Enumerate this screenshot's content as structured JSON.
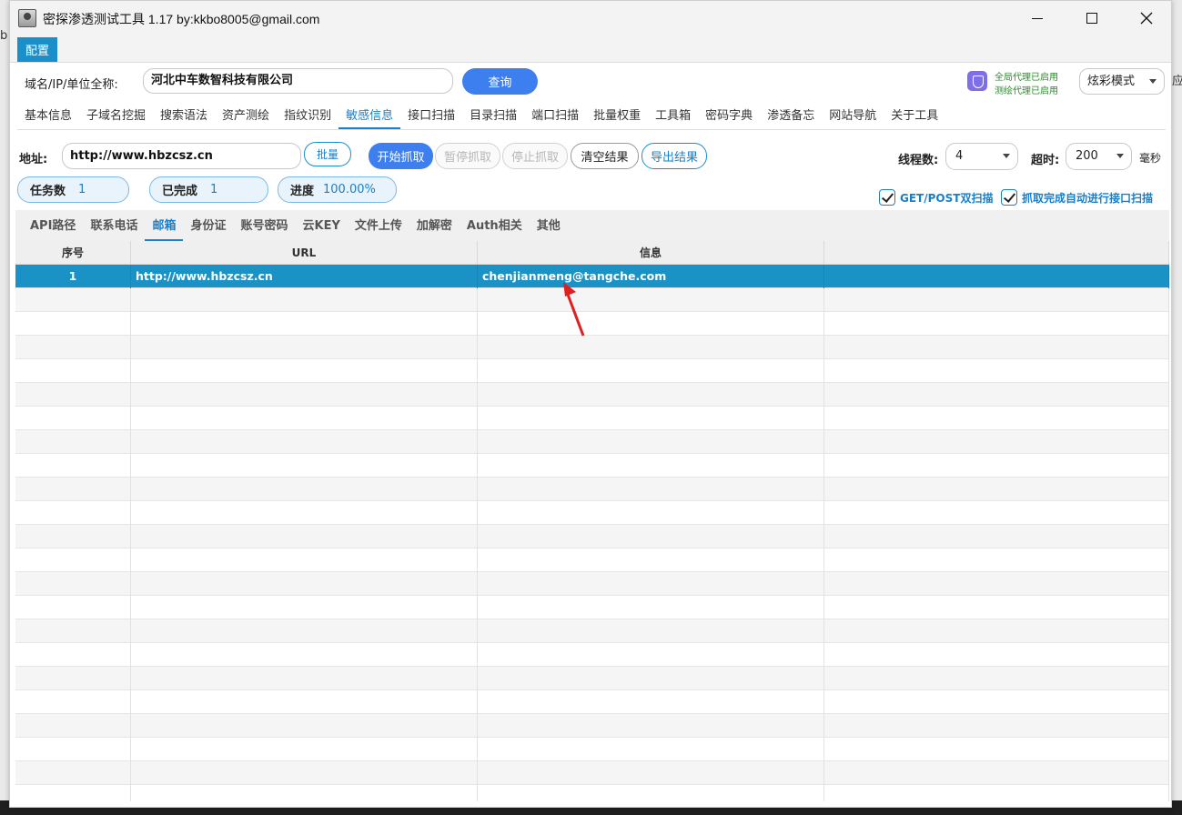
{
  "window": {
    "title": "密探渗透测试工具 1.17 by:kkbo8005@gmail.com",
    "menu": {
      "config": "配置"
    }
  },
  "background": {
    "left_glyph": "b",
    "right_glyph": "应"
  },
  "query_bar": {
    "label": "域名/IP/单位全称:",
    "value": "河北中车数智科技有限公司",
    "query_button": "查询",
    "proxy_global": "全局代理已启用",
    "proxy_test": "测绘代理已启用",
    "mode": "炫彩模式"
  },
  "main_tabs": [
    {
      "label": "基本信息",
      "active": false
    },
    {
      "label": "子域名挖掘",
      "active": false
    },
    {
      "label": "搜索语法",
      "active": false
    },
    {
      "label": "资产测绘",
      "active": false
    },
    {
      "label": "指纹识别",
      "active": false
    },
    {
      "label": "敏感信息",
      "active": true
    },
    {
      "label": "接口扫描",
      "active": false
    },
    {
      "label": "目录扫描",
      "active": false
    },
    {
      "label": "端口扫描",
      "active": false
    },
    {
      "label": "批量权重",
      "active": false
    },
    {
      "label": "工具箱",
      "active": false
    },
    {
      "label": "密码字典",
      "active": false
    },
    {
      "label": "渗透备忘",
      "active": false
    },
    {
      "label": "网站导航",
      "active": false
    },
    {
      "label": "关于工具",
      "active": false
    }
  ],
  "scan": {
    "addr_label": "地址:",
    "addr_value": "http://www.hbzcsz.cn",
    "batch": "批量",
    "start": "开始抓取",
    "pause": "暂停抓取",
    "stop": "停止抓取",
    "clear": "清空结果",
    "export": "导出结果",
    "threads_label": "线程数:",
    "threads_value": "4",
    "timeout_label": "超时:",
    "timeout_value": "200",
    "ms": "毫秒"
  },
  "stats": {
    "tasks_label": "任务数",
    "tasks_value": "1",
    "done_label": "已完成",
    "done_value": "1",
    "progress_label": "进度",
    "progress_value": "100.00%",
    "opt_getpost": "GET/POST双扫描",
    "opt_auto": "抓取完成自动进行接口扫描"
  },
  "sub_tabs": [
    {
      "label": "API路径",
      "active": false
    },
    {
      "label": "联系电话",
      "active": false
    },
    {
      "label": "邮箱",
      "active": true
    },
    {
      "label": "身份证",
      "active": false
    },
    {
      "label": "账号密码",
      "active": false
    },
    {
      "label": "云KEY",
      "active": false
    },
    {
      "label": "文件上传",
      "active": false
    },
    {
      "label": "加解密",
      "active": false
    },
    {
      "label": "Auth相关",
      "active": false
    },
    {
      "label": "其他",
      "active": false
    }
  ],
  "table": {
    "columns": [
      "序号",
      "URL",
      "信息",
      ""
    ],
    "rows": [
      {
        "index": "1",
        "url": "http://www.hbzcsz.cn",
        "info": "chenjianmeng@tangche.com",
        "selected": true
      }
    ],
    "empty_rows": 22
  },
  "colors": {
    "accent": "#1a8fc9",
    "primary_button": "#3d7fef",
    "selected_row": "#1a92c6",
    "annotation": "#e02020"
  }
}
